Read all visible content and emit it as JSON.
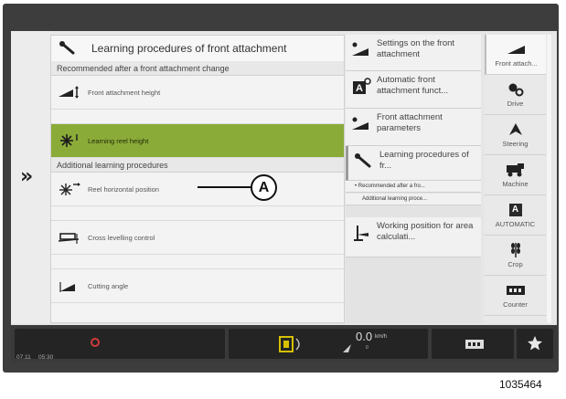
{
  "main": {
    "title": "Learning procedures of front attachment",
    "recommended_heading": "Recommended after a front attachment change",
    "items_recommended": [
      {
        "label": "Front attachment height",
        "icon": "front-attachment-height-icon",
        "selected": false
      },
      {
        "label": "Learning reel height",
        "icon": "reel-height-icon",
        "selected": true
      }
    ],
    "additional_heading": "Additional learning procedures",
    "items_additional": [
      {
        "label": "Reel horizontal position",
        "icon": "reel-horizontal-icon"
      },
      {
        "label": "Cross levelling control",
        "icon": "cross-levelling-icon"
      },
      {
        "label": "Cutting angle",
        "icon": "cutting-angle-icon"
      }
    ],
    "expand_chevron": "»"
  },
  "callout": {
    "label": "A"
  },
  "middle": {
    "items": [
      {
        "label": "Settings on the front attachment",
        "icon": "settings-front-attachment-icon"
      },
      {
        "label": "Automatic front attachment funct...",
        "icon": "automatic-front-attachment-icon"
      },
      {
        "label": "Front attachment parameters",
        "icon": "front-attachment-parameters-icon"
      },
      {
        "label": "Learning procedures of fr...",
        "icon": "learning-procedures-icon"
      },
      {
        "label": "Working position for area calculati...",
        "icon": "working-position-icon"
      }
    ],
    "sub_recommended": "• Recommended after a fro...",
    "sub_additional": "Additional learning proce..."
  },
  "nav": {
    "items": [
      {
        "label": "Front attach...",
        "icon": "front-attachment-icon",
        "active": true
      },
      {
        "label": "Drive",
        "icon": "drive-icon",
        "active": false
      },
      {
        "label": "Steering",
        "icon": "steering-icon",
        "active": false
      },
      {
        "label": "Machine",
        "icon": "machine-icon",
        "active": false
      },
      {
        "label": "AUTOMATIC",
        "icon": "automatic-icon",
        "active": false,
        "badge": "A"
      },
      {
        "label": "Crop",
        "icon": "crop-icon",
        "active": false
      },
      {
        "label": "Counter",
        "icon": "counter-icon",
        "active": false
      }
    ]
  },
  "status": {
    "date": "07.11",
    "time": "05:30",
    "speed_value": "0.0",
    "speed_unit": "km/h",
    "speed_sub": "0"
  },
  "figure_ref": "1035464",
  "colors": {
    "selected_row": "#8bab39",
    "bezel": "#3d3d3d",
    "status_bar": "#3a3a3a",
    "alert_red": "#d23a3a"
  }
}
